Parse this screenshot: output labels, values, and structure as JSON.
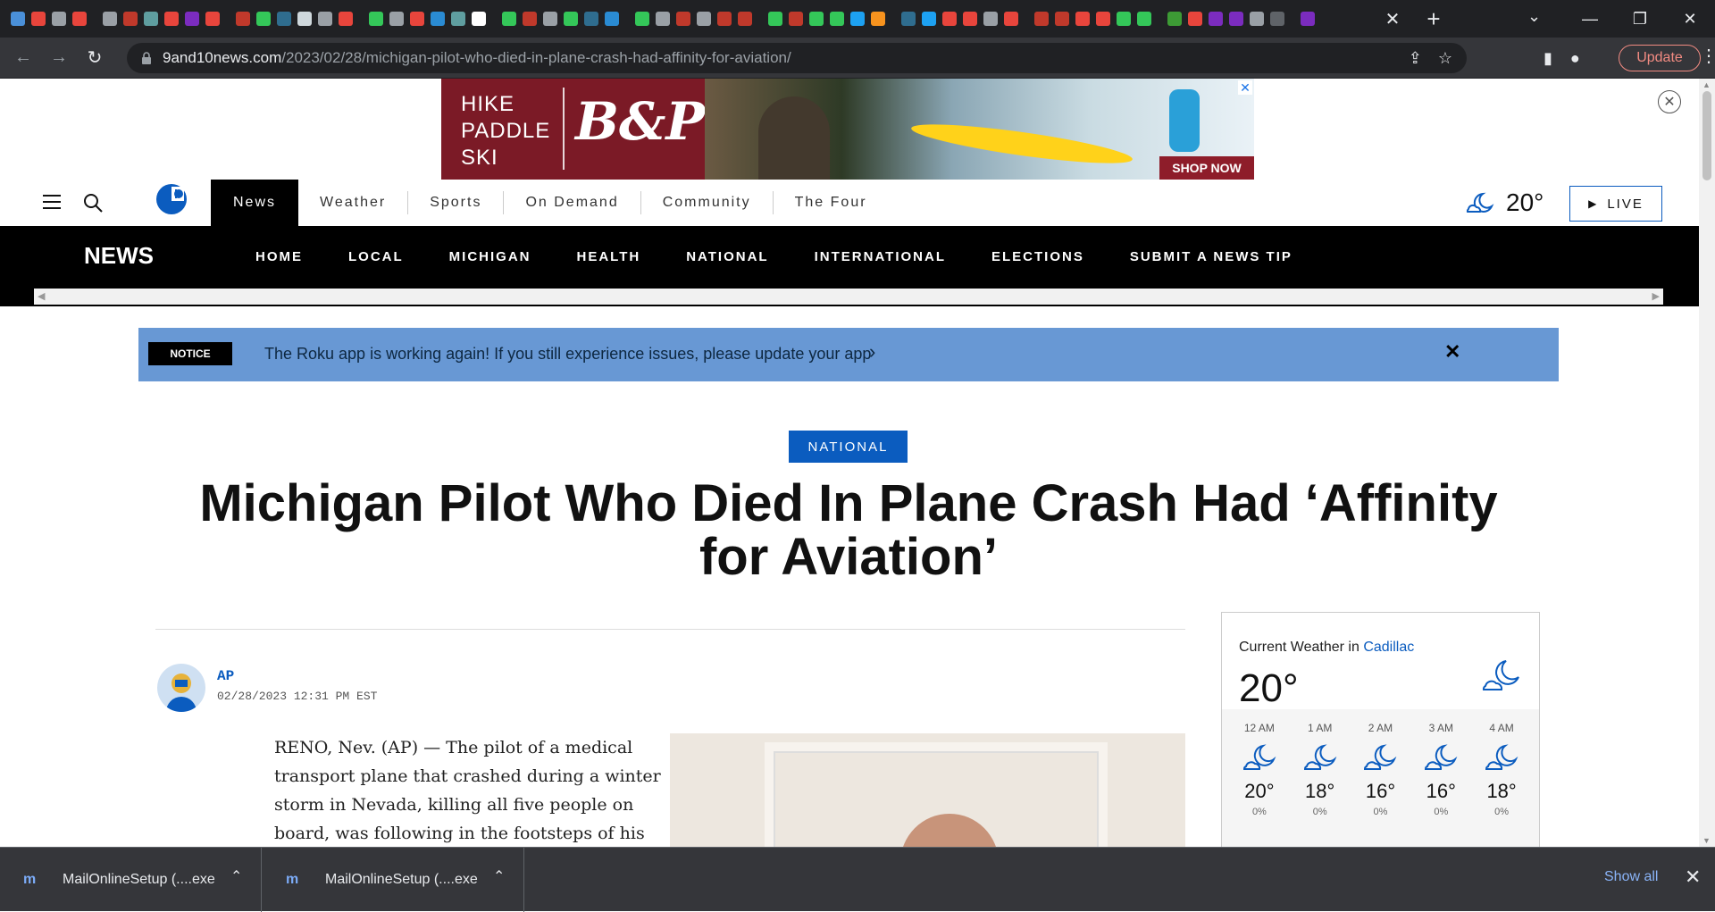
{
  "browser": {
    "tab_favicon_colors": [
      "#4a90d9",
      "#e8453c",
      "#9aa0a6",
      "#e8453c",
      "#9aa0a6",
      "#c0392b",
      "#5f9ea0",
      "#e8453c",
      "#7b2cbf",
      "#e8453c",
      "#c0392b",
      "#34c759",
      "#2f6d8f",
      "#cfd8dc",
      "#9aa0a6",
      "#e8453c",
      "#34c759",
      "#9aa0a6",
      "#e8453c",
      "#2a8bd3",
      "#5f9ea0",
      "#ffffff",
      "#34c759",
      "#c0392b",
      "#9aa0a6",
      "#34c759",
      "#2f6d8f",
      "#2a8bd3",
      "#34c759",
      "#9aa0a6",
      "#c0392b",
      "#9aa0a6",
      "#c0392b",
      "#c0392b",
      "#34c759",
      "#c0392b",
      "#34c759",
      "#34c759",
      "#1da1f2",
      "#f7931e",
      "#2f6d8f",
      "#1da1f2",
      "#e8453c",
      "#e8453c",
      "#9aa0a6",
      "#e8453c",
      "#c0392b",
      "#c0392b",
      "#e8453c",
      "#e8453c",
      "#34c759",
      "#34c759",
      "#3d9b35",
      "#e8453c",
      "#7b2cbf",
      "#7b2cbf",
      "#9aa0a6",
      "#5f6368",
      "#7b2cbf"
    ],
    "tab_close_icon": "close-icon",
    "new_tab_label": "+",
    "url_host": "9and10news.com",
    "url_path": "/2023/02/28/michigan-pilot-who-died-in-plane-crash-had-affinity-for-aviation/",
    "update_label": "Update"
  },
  "ad": {
    "words": [
      "HIKE",
      "PADDLE",
      "SKI"
    ],
    "logo": "B&P",
    "cta": "SHOP NOW"
  },
  "header": {
    "tabs": [
      "News",
      "Weather",
      "Sports",
      "On Demand",
      "Community",
      "The Four"
    ],
    "active_tab": "News",
    "temperature": "20°",
    "live_label": "LIVE"
  },
  "section_nav": {
    "title": "NEWS",
    "items": [
      "HOME",
      "LOCAL",
      "MICHIGAN",
      "HEALTH",
      "NATIONAL",
      "INTERNATIONAL",
      "ELECTIONS",
      "SUBMIT A NEWS TIP"
    ]
  },
  "notice": {
    "tag": "NOTICE",
    "text": "The Roku app is working again! If you still experience issues, please update your app"
  },
  "article": {
    "category": "NATIONAL",
    "headline": "Michigan Pilot Who Died In Plane Crash Had ‘Affinity for Aviation’",
    "author": "AP",
    "date": "02/28/2023 12:31 PM EST",
    "body": "RENO, Nev. (AP) — The pilot of a medical transport plane that crashed during a winter storm in Nevada, killing all five people on board, was following in the footsteps of his"
  },
  "weather_card": {
    "title_prefix": "Current Weather in ",
    "city": "Cadillac",
    "current_temp": "20°",
    "hours": [
      {
        "time": "12 AM",
        "temp": "20°",
        "precip": "0%"
      },
      {
        "time": "1 AM",
        "temp": "18°",
        "precip": "0%"
      },
      {
        "time": "2 AM",
        "temp": "16°",
        "precip": "0%"
      },
      {
        "time": "3 AM",
        "temp": "16°",
        "precip": "0%"
      },
      {
        "time": "4 AM",
        "temp": "18°",
        "precip": "0%"
      }
    ]
  },
  "downloads": {
    "items": [
      "MailOnlineSetup (....exe",
      "MailOnlineSetup (....exe"
    ],
    "show_all": "Show all"
  },
  "colors": {
    "brand_blue": "#0b5cbf",
    "notice_bg": "#6898d4",
    "chrome_dark": "#202124"
  }
}
